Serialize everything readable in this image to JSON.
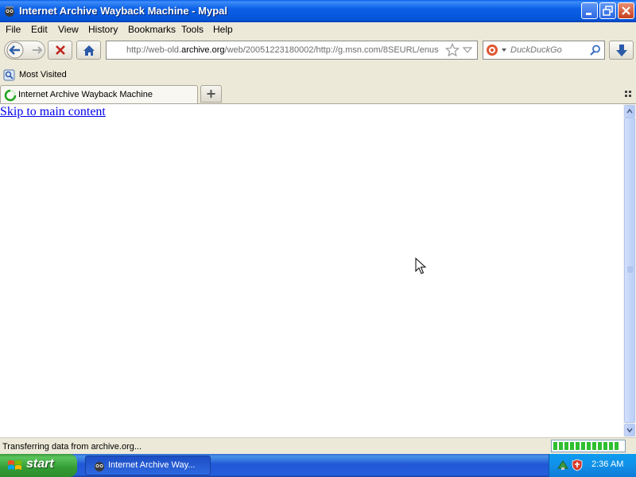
{
  "window": {
    "title": "Internet Archive Wayback Machine - Mypal"
  },
  "menu": [
    "File",
    "Edit",
    "View",
    "History",
    "Bookmarks",
    "Tools",
    "Help"
  ],
  "navigation": {
    "url_prefix": "http://web-old.",
    "url_domain": "archive.org",
    "url_suffix": "/web/20051223180002/http://g.msn.com/8SEURL/enus",
    "search_placeholder": "DuckDuckGo"
  },
  "bookmarks": {
    "most_visited": "Most Visited"
  },
  "tabs": [
    {
      "label": "Internet Archive Wayback Machine",
      "active": true
    }
  ],
  "page": {
    "skip_link": "Skip to main content"
  },
  "status": {
    "text": "Transferring data from archive.org...",
    "progress_segments_filled": 12,
    "progress_segments_total": 12
  },
  "taskbar": {
    "start_label": "start",
    "task_label": "Internet Archive Way...",
    "clock": "2:36 AM"
  },
  "colors": {
    "titlebar": "#0B60E6",
    "taskbar": "#245EDB",
    "start": "#349C34",
    "link": "#0000EE",
    "progress": "#2FBF2F"
  },
  "icons": [
    "mypal-logo-icon",
    "minimize-icon",
    "maximize-icon",
    "close-icon",
    "back-arrow-icon",
    "forward-arrow-icon",
    "stop-icon",
    "home-icon",
    "bookmark-star-icon",
    "dropdown-arrow-icon",
    "duckduckgo-icon",
    "search-icon",
    "download-icon",
    "most-visited-icon",
    "loading-spinner-icon",
    "plus-icon",
    "tab-list-icon",
    "scroll-up-icon",
    "scroll-down-icon",
    "windows-logo-icon",
    "network-icon",
    "shield-icon",
    "mouse-cursor-icon"
  ]
}
